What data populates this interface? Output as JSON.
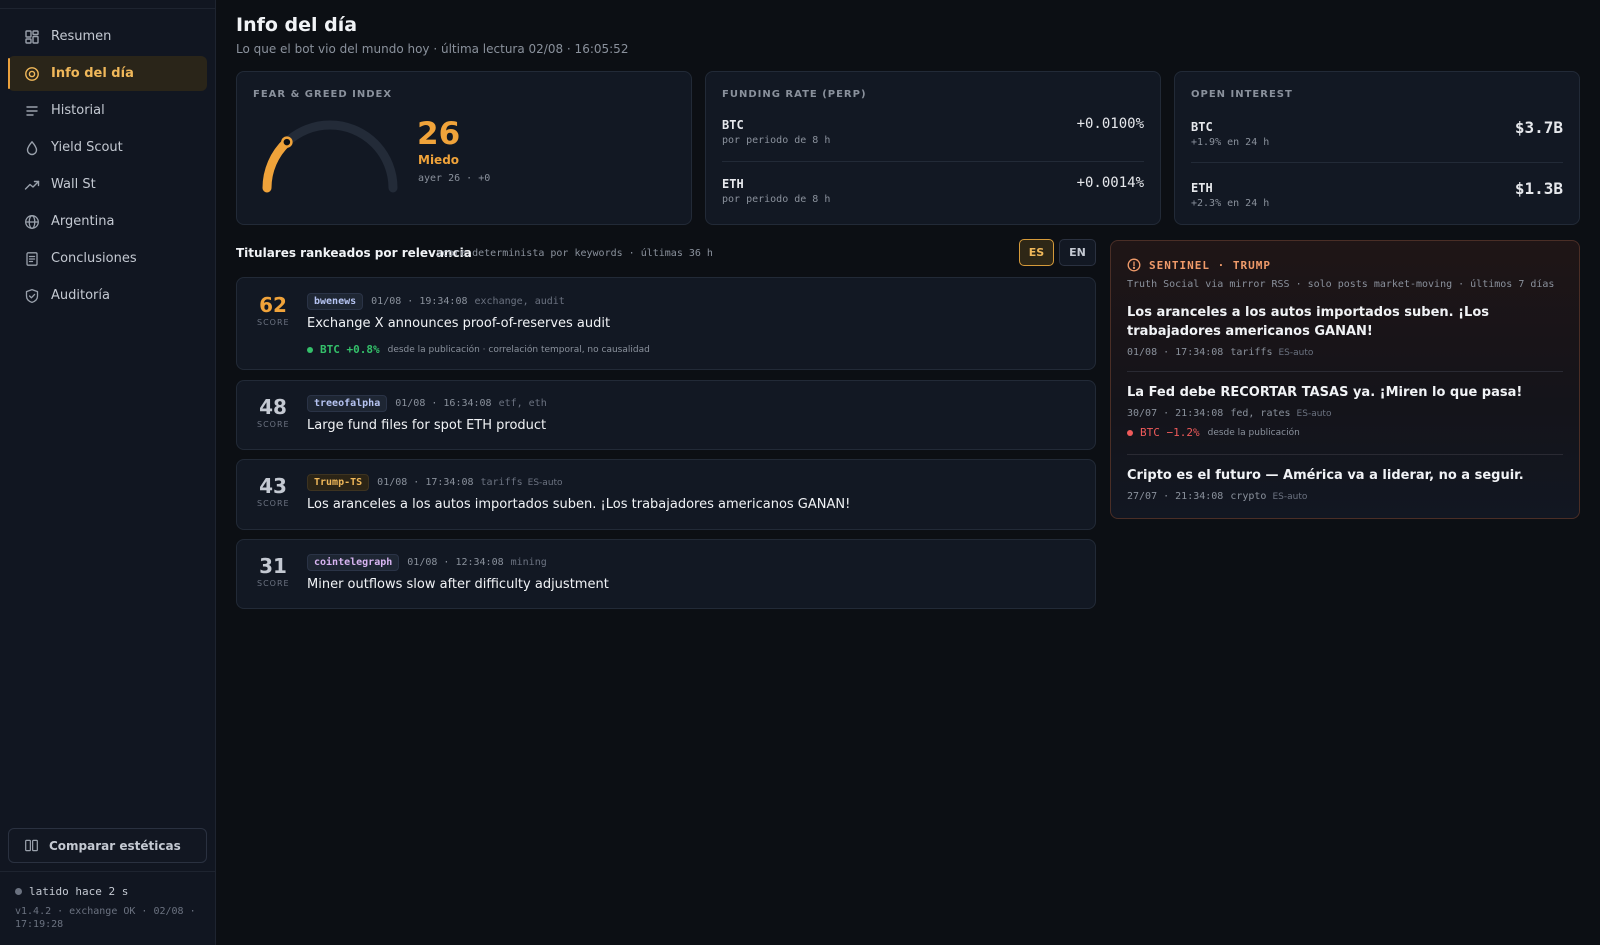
{
  "sidebar": {
    "items": [
      {
        "label": "Resumen",
        "icon": "grid-icon"
      },
      {
        "label": "Info del día",
        "icon": "target-icon",
        "active": true
      },
      {
        "label": "Historial",
        "icon": "list-icon"
      },
      {
        "label": "Yield Scout",
        "icon": "droplet-icon"
      },
      {
        "label": "Wall St",
        "icon": "trending-up-icon"
      },
      {
        "label": "Argentina",
        "icon": "globe-icon"
      },
      {
        "label": "Conclusiones",
        "icon": "document-icon"
      },
      {
        "label": "Auditoría",
        "icon": "shield-icon"
      }
    ],
    "compare_label": "Comparar estéticas",
    "heartbeat": "latido hace 2 s",
    "version": "v1.4.2 · exchange OK · 02/08 · 17:19:28"
  },
  "header": {
    "title": "Info del día",
    "subtitle": "Lo que el bot vio del mundo hoy · última lectura 02/08 · 16:05:52"
  },
  "fear_greed": {
    "label": "FEAR & GREED INDEX",
    "value": 26,
    "value_text": "26",
    "sentiment": "Miedo",
    "yesterday": "ayer 26 · +0",
    "color": "#f0a33a"
  },
  "funding": {
    "label": "FUNDING RATE (PERP)",
    "rows": [
      {
        "name": "BTC",
        "sub": "por periodo de 8 h",
        "value": "+0.0100%"
      },
      {
        "name": "ETH",
        "sub": "por periodo de 8 h",
        "value": "+0.0014%"
      }
    ]
  },
  "open_interest": {
    "label": "OPEN INTEREST",
    "rows": [
      {
        "name": "BTC",
        "sub": "+1.9% en 24 h",
        "value": "$3.7B"
      },
      {
        "name": "ETH",
        "sub": "+2.3% en 24 h",
        "value": "$1.3B"
      }
    ]
  },
  "headlines": {
    "title": "Titulares rankeados por relevancia",
    "subtitle": "score determinista por keywords · últimas 36 h",
    "lang_es": "ES",
    "lang_en": "EN",
    "score_label": "SCORE",
    "items": [
      {
        "score": "62",
        "source": "bwenews",
        "time": "01/08 · 19:34:08",
        "tags": "exchange, audit",
        "auto": "",
        "text": "Exchange X announces proof-of-reserves audit",
        "impact": "BTC +0.8%",
        "impact_note": "desde la publicación · correlación temporal, no causalidad"
      },
      {
        "score": "48",
        "source": "treeofalpha",
        "time": "01/08 · 16:34:08",
        "tags": "etf, eth",
        "auto": "",
        "text": "Large fund files for spot ETH product"
      },
      {
        "score": "43",
        "source": "Trump-TS",
        "time": "01/08 · 17:34:08",
        "tags": "tariffs",
        "auto": "ES-auto",
        "text": "Los aranceles a los autos importados suben. ¡Los trabajadores americanos GANAN!"
      },
      {
        "score": "31",
        "source": "cointelegraph",
        "time": "01/08 · 12:34:08",
        "tags": "mining",
        "auto": "",
        "text": "Miner outflows slow after difficulty adjustment"
      }
    ]
  },
  "sentinel": {
    "title": "SENTINEL · TRUMP",
    "subtitle": "Truth Social via mirror RSS · solo posts market-moving · últimos 7 días",
    "posts": [
      {
        "text": "Los aranceles a los autos importados suben. ¡Los trabajadores americanos GANAN!",
        "time": "01/08 · 17:34:08",
        "tags": "tariffs",
        "auto": "ES-auto"
      },
      {
        "text": "La Fed debe RECORTAR TASAS ya. ¡Miren lo que pasa!",
        "time": "30/07 · 21:34:08",
        "tags": "fed, rates",
        "auto": "ES-auto",
        "impact": "BTC −1.2%",
        "impact_note": "desde la publicación"
      },
      {
        "text": "Cripto es el futuro — América va a liderar, no a seguir.",
        "time": "27/07 · 21:34:08",
        "tags": "crypto",
        "auto": "ES-auto"
      }
    ]
  }
}
